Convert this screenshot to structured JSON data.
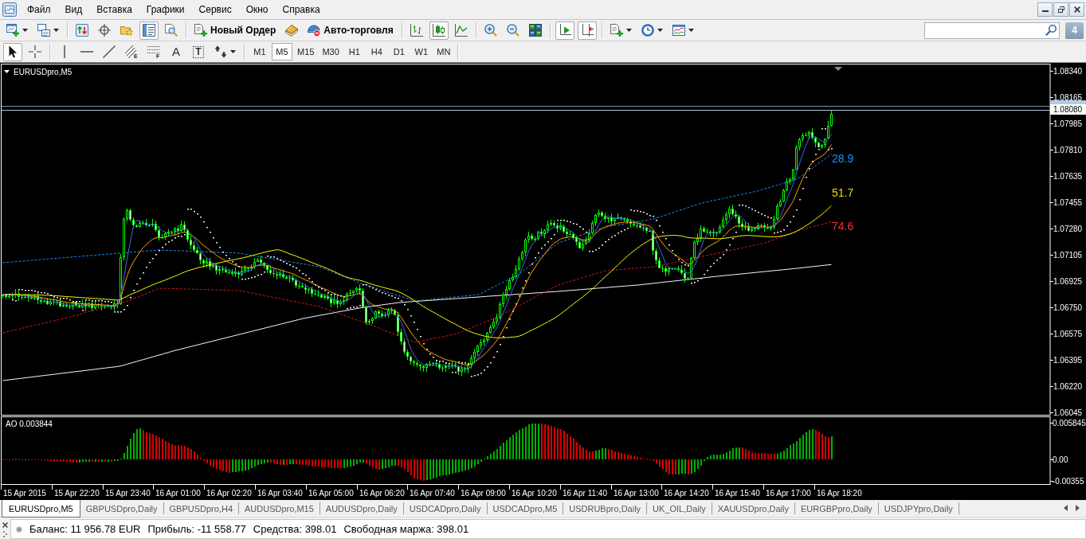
{
  "menu": {
    "items": [
      "Файл",
      "Вид",
      "Вставка",
      "Графики",
      "Сервис",
      "Окно",
      "Справка"
    ]
  },
  "toolbar_main": {
    "groups": [
      [
        {
          "pressed": false,
          "dropdown": true
        },
        {
          "pressed": false,
          "dropdown": true
        }
      ],
      [
        {
          "pressed": false
        },
        {
          "pressed": false
        },
        {
          "pressed": false
        },
        {
          "pressed": true
        },
        {
          "pressed": false
        }
      ],
      [
        {
          "label": "Новый Ордер",
          "pressed": false
        },
        {
          "pressed": false
        },
        {
          "label": "Авто-торговля",
          "pressed": false
        }
      ],
      [
        {
          "pressed": false
        },
        {
          "pressed": true
        },
        {
          "pressed": false
        }
      ],
      [
        {
          "pressed": false
        },
        {
          "pressed": false
        },
        {
          "pressed": false
        }
      ],
      [
        {
          "pressed": true
        },
        {
          "pressed": true
        }
      ],
      [
        {
          "pressed": false,
          "dropdown": true
        },
        {
          "pressed": false,
          "dropdown": true
        },
        {
          "pressed": false,
          "dropdown": true
        }
      ]
    ]
  },
  "notifications": {
    "count": "4"
  },
  "toolbar_tools": {
    "groups": [
      [
        {
          "pressed": true
        },
        {
          "pressed": false
        }
      ],
      [
        {
          "pressed": false
        },
        {
          "pressed": false
        },
        {
          "pressed": false
        },
        {
          "glyph": "E",
          "pressed": false
        },
        {
          "glyph": "F",
          "pressed": false
        },
        {
          "glyph": "A",
          "pressed": false
        },
        {
          "glyph": "T",
          "pressed": false
        },
        {
          "pressed": false,
          "dropdown": true
        }
      ]
    ]
  },
  "timeframes": [
    {
      "label": "M1",
      "selected": false
    },
    {
      "label": "M5",
      "selected": true
    },
    {
      "label": "M15",
      "selected": false
    },
    {
      "label": "M30",
      "selected": false
    },
    {
      "label": "H1",
      "selected": false
    },
    {
      "label": "H4",
      "selected": false
    },
    {
      "label": "D1",
      "selected": false
    },
    {
      "label": "W1",
      "selected": false
    },
    {
      "label": "MN",
      "selected": false
    }
  ],
  "chart": {
    "title": "EURUSDpro,M5",
    "price_axis": [
      "1.08340",
      "1.08165",
      "1.07985",
      "1.07810",
      "1.07635",
      "1.07455",
      "1.07280",
      "1.07105",
      "1.06925",
      "1.06750",
      "1.06575",
      "1.06395",
      "1.06220",
      "1.06045"
    ],
    "bid_label": "1.08080",
    "indicator_labels": [
      {
        "text": "28.9",
        "color": "#1e90ff"
      },
      {
        "text": "51.7",
        "color": "#ffd700"
      },
      {
        "text": "74.6",
        "color": "#ff3030"
      }
    ],
    "time_axis": [
      "15 Apr 2015",
      "15 Apr 22:20",
      "15 Apr 23:40",
      "16 Apr 01:00",
      "16 Apr 02:20",
      "16 Apr 03:40",
      "16 Apr 05:00",
      "16 Apr 06:20",
      "16 Apr 07:40",
      "16 Apr 09:00",
      "16 Apr 10:20",
      "16 Apr 11:40",
      "16 Apr 13:00",
      "16 Apr 14:20",
      "16 Apr 15:40",
      "16 Apr 17:00",
      "16 Apr 18:20"
    ]
  },
  "oscillator": {
    "title": "AO 0.003844",
    "axis": [
      "0.005845",
      "0.00",
      "-0.00355"
    ]
  },
  "tabs": [
    {
      "label": "EURUSDpro,M5",
      "selected": true
    },
    {
      "label": "GBPUSDpro,Daily",
      "selected": false
    },
    {
      "label": "GBPUSDpro,H4",
      "selected": false
    },
    {
      "label": "AUDUSDpro,M15",
      "selected": false
    },
    {
      "label": "AUDUSDpro,Daily",
      "selected": false
    },
    {
      "label": "USDCADpro,Daily",
      "selected": false
    },
    {
      "label": "USDCADpro,M5",
      "selected": false
    },
    {
      "label": "USDRUBpro,Daily",
      "selected": false
    },
    {
      "label": "UK_OIL,Daily",
      "selected": false
    },
    {
      "label": "XAUUSDpro,Daily",
      "selected": false
    },
    {
      "label": "EURGBPpro,Daily",
      "selected": false
    },
    {
      "label": "USDJPYpro,Daily",
      "selected": false
    }
  ],
  "status_bar": {
    "items": [
      "Баланс: 11 956.78 EUR",
      "Прибыль: -11 558.77",
      "Средства: 398.01",
      "Свободная маржа: 398.01"
    ]
  }
}
